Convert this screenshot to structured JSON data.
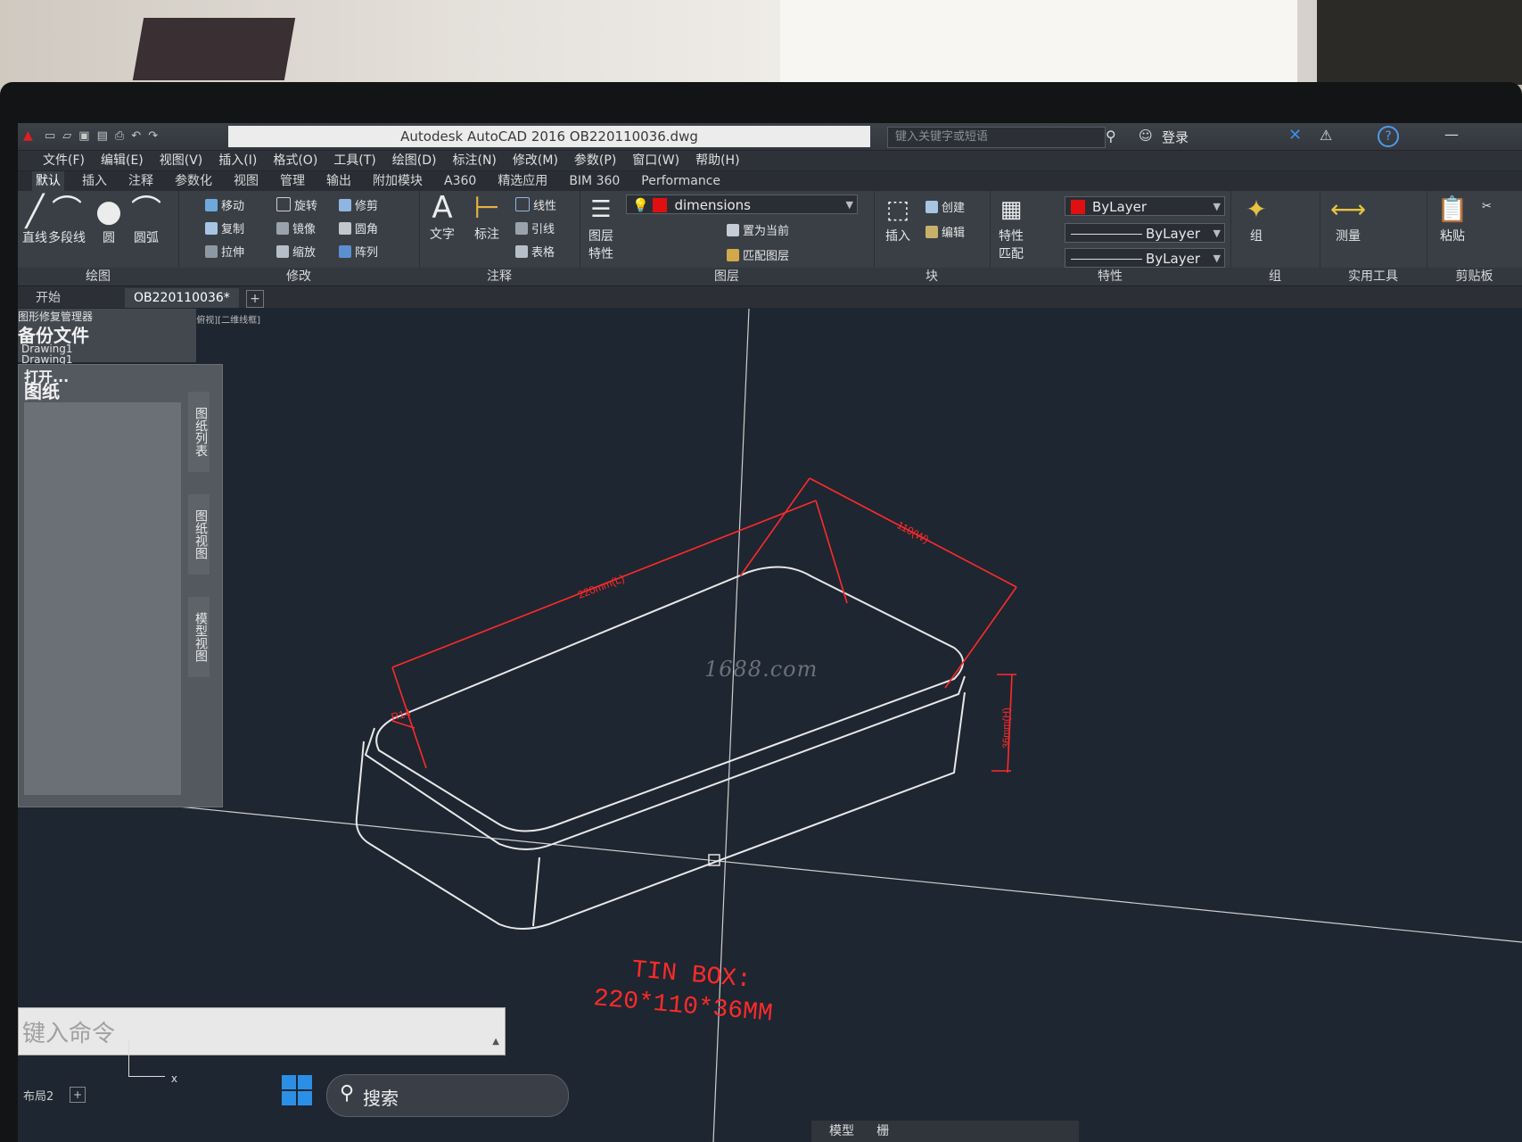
{
  "titlebar": {
    "title": "Autodesk AutoCAD 2016    OB220110036.dwg",
    "search_placeholder": "键入关键字或短语",
    "login": "登录",
    "help": "?"
  },
  "menubar": [
    "文件(F)",
    "编辑(E)",
    "视图(V)",
    "插入(I)",
    "格式(O)",
    "工具(T)",
    "绘图(D)",
    "标注(N)",
    "修改(M)",
    "参数(P)",
    "窗口(W)",
    "帮助(H)"
  ],
  "ribbon_tabs": [
    "默认",
    "插入",
    "注释",
    "参数化",
    "视图",
    "管理",
    "输出",
    "附加模块",
    "A360",
    "精选应用",
    "BIM 360",
    "Performance"
  ],
  "ribbon": {
    "draw": {
      "title": "绘图",
      "line": "直线",
      "polyline": "多段线",
      "circle": "圆",
      "arc": "圆弧"
    },
    "modify": {
      "title": "修改",
      "move": "移动",
      "rotate": "旋转",
      "trim": "修剪",
      "copy": "复制",
      "mirror": "镜像",
      "fillet": "圆角",
      "stretch": "拉伸",
      "scale": "缩放",
      "array": "阵列"
    },
    "annotation": {
      "title": "注释",
      "text": "文字",
      "dimension": "标注",
      "linear": "线性",
      "leader": "引线",
      "table": "表格"
    },
    "layers": {
      "title": "图层",
      "props": "图层\n特性",
      "current_layer": "dimensions",
      "set_current": "置为当前",
      "match_layer": "匹配图层"
    },
    "block": {
      "title": "块",
      "insert": "插入",
      "create": "创建",
      "edit": "编辑"
    },
    "properties": {
      "title": "特性",
      "match": "特性\n匹配",
      "color": "ByLayer",
      "linetype": "ByLayer",
      "lineweight": "ByLayer"
    },
    "groups": {
      "title": "组",
      "group": "组"
    },
    "utilities": {
      "title": "实用工具",
      "measure": "测量"
    },
    "clipboard": {
      "title": "剪贴板",
      "paste": "粘贴"
    }
  },
  "doc_tabs": {
    "start": "开始",
    "file": "OB220110036*"
  },
  "viewport_label": "[-][俯视][二维线框]",
  "recovery": {
    "title": "图形修复管理器",
    "heading": "备份文件",
    "item1": "Drawing1",
    "item2": "Drawing1"
  },
  "sheetset": {
    "open": "打开...",
    "heading": "图纸",
    "vtabs": [
      "图纸列表",
      "图纸视图",
      "模型视图"
    ]
  },
  "command_line": {
    "placeholder": "键入命令"
  },
  "layout_tab": "布局2",
  "drawing": {
    "dim_length": "220mm(L)",
    "dim_width": "110(W)",
    "dim_height": "36mm(H)",
    "radius": "R14",
    "note_line1": "TIN BOX:",
    "note_line2": "220*110*36MM",
    "dim_color": "#ff2a2a",
    "line_color": "#e8e8e8"
  },
  "watermark": "1688.com",
  "taskbar": {
    "search": "搜索"
  },
  "statusbar": [
    "模型",
    "栅"
  ]
}
